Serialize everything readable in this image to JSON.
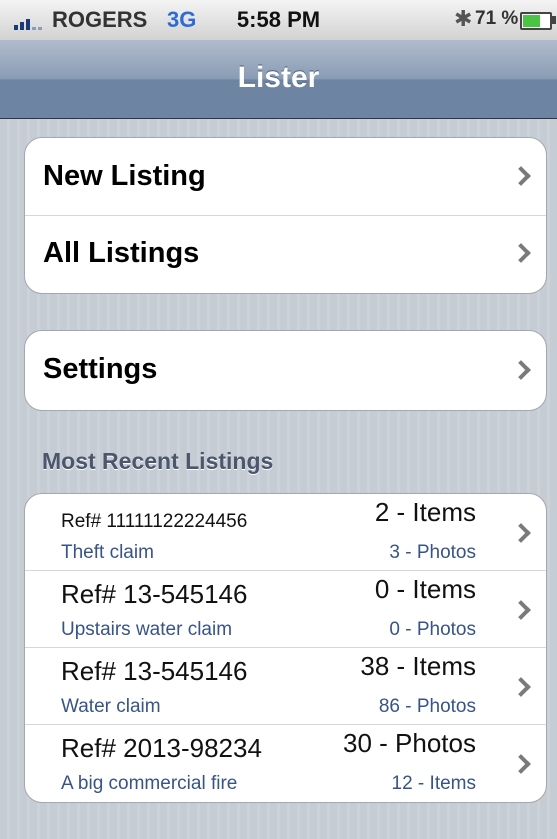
{
  "status_bar": {
    "carrier": "ROGERS",
    "network": "3G",
    "time": "5:58 PM",
    "battery_percent": "71 %",
    "battery_level": 0.71
  },
  "nav": {
    "title": "Lister"
  },
  "menu": {
    "new_listing": "New Listing",
    "all_listings": "All Listings",
    "settings": "Settings"
  },
  "recent": {
    "header": "Most Recent Listings",
    "items": [
      {
        "ref": "Ref# 11111122224456",
        "desc": "Theft claim",
        "count1": "2 - Items",
        "count2": "3 - Photos"
      },
      {
        "ref": "Ref# 13-545146",
        "desc": "Upstairs water claim",
        "count1": "0 - Items",
        "count2": "0 - Photos"
      },
      {
        "ref": "Ref# 13-545146",
        "desc": "Water claim",
        "count1": "38 - Items",
        "count2": "86 - Photos"
      },
      {
        "ref": "Ref# 2013-98234",
        "desc": "A big commercial fire",
        "count1": "30 - Photos",
        "count2": "12 - Items"
      }
    ]
  },
  "colors": {
    "nav_bar": "#6d84a2",
    "group_text_blue": "#385487",
    "section_header": "#4c566c"
  }
}
